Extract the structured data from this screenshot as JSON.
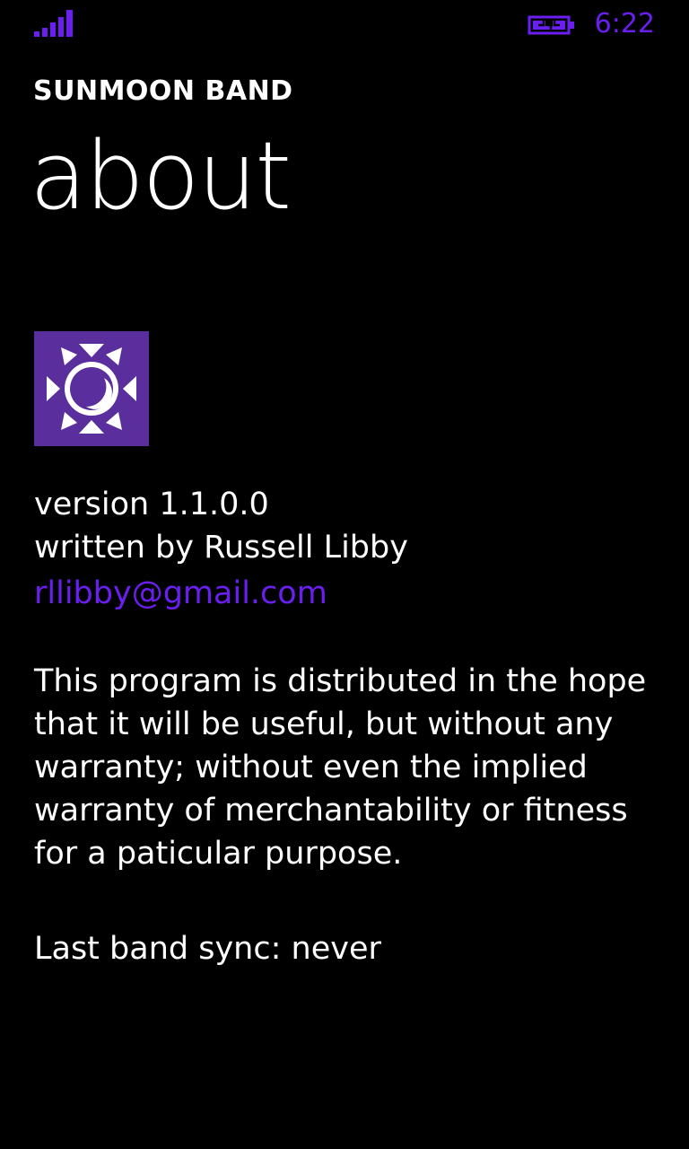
{
  "colors": {
    "accent": "#6a1ef0",
    "background": "#000000",
    "text": "#ffffff",
    "logo_bg": "#5a2e9c"
  },
  "status_bar": {
    "signal_icon": "signal-strength-icon",
    "battery_icon": "battery-charging-icon",
    "time": "6:22"
  },
  "header": {
    "app_title": "SUNMOON BAND",
    "page_title": "about"
  },
  "logo": {
    "icon": "sun-moon-icon"
  },
  "info": {
    "version": "version 1.1.0.0",
    "author": "written by Russell Libby",
    "email": "rllibby@gmail.com"
  },
  "disclaimer": "This program is distributed in the hope that it will be useful, but without any warranty; without even the implied warranty of merchantability or fitness for a paticular purpose.",
  "sync": {
    "status": "Last band sync: never"
  }
}
